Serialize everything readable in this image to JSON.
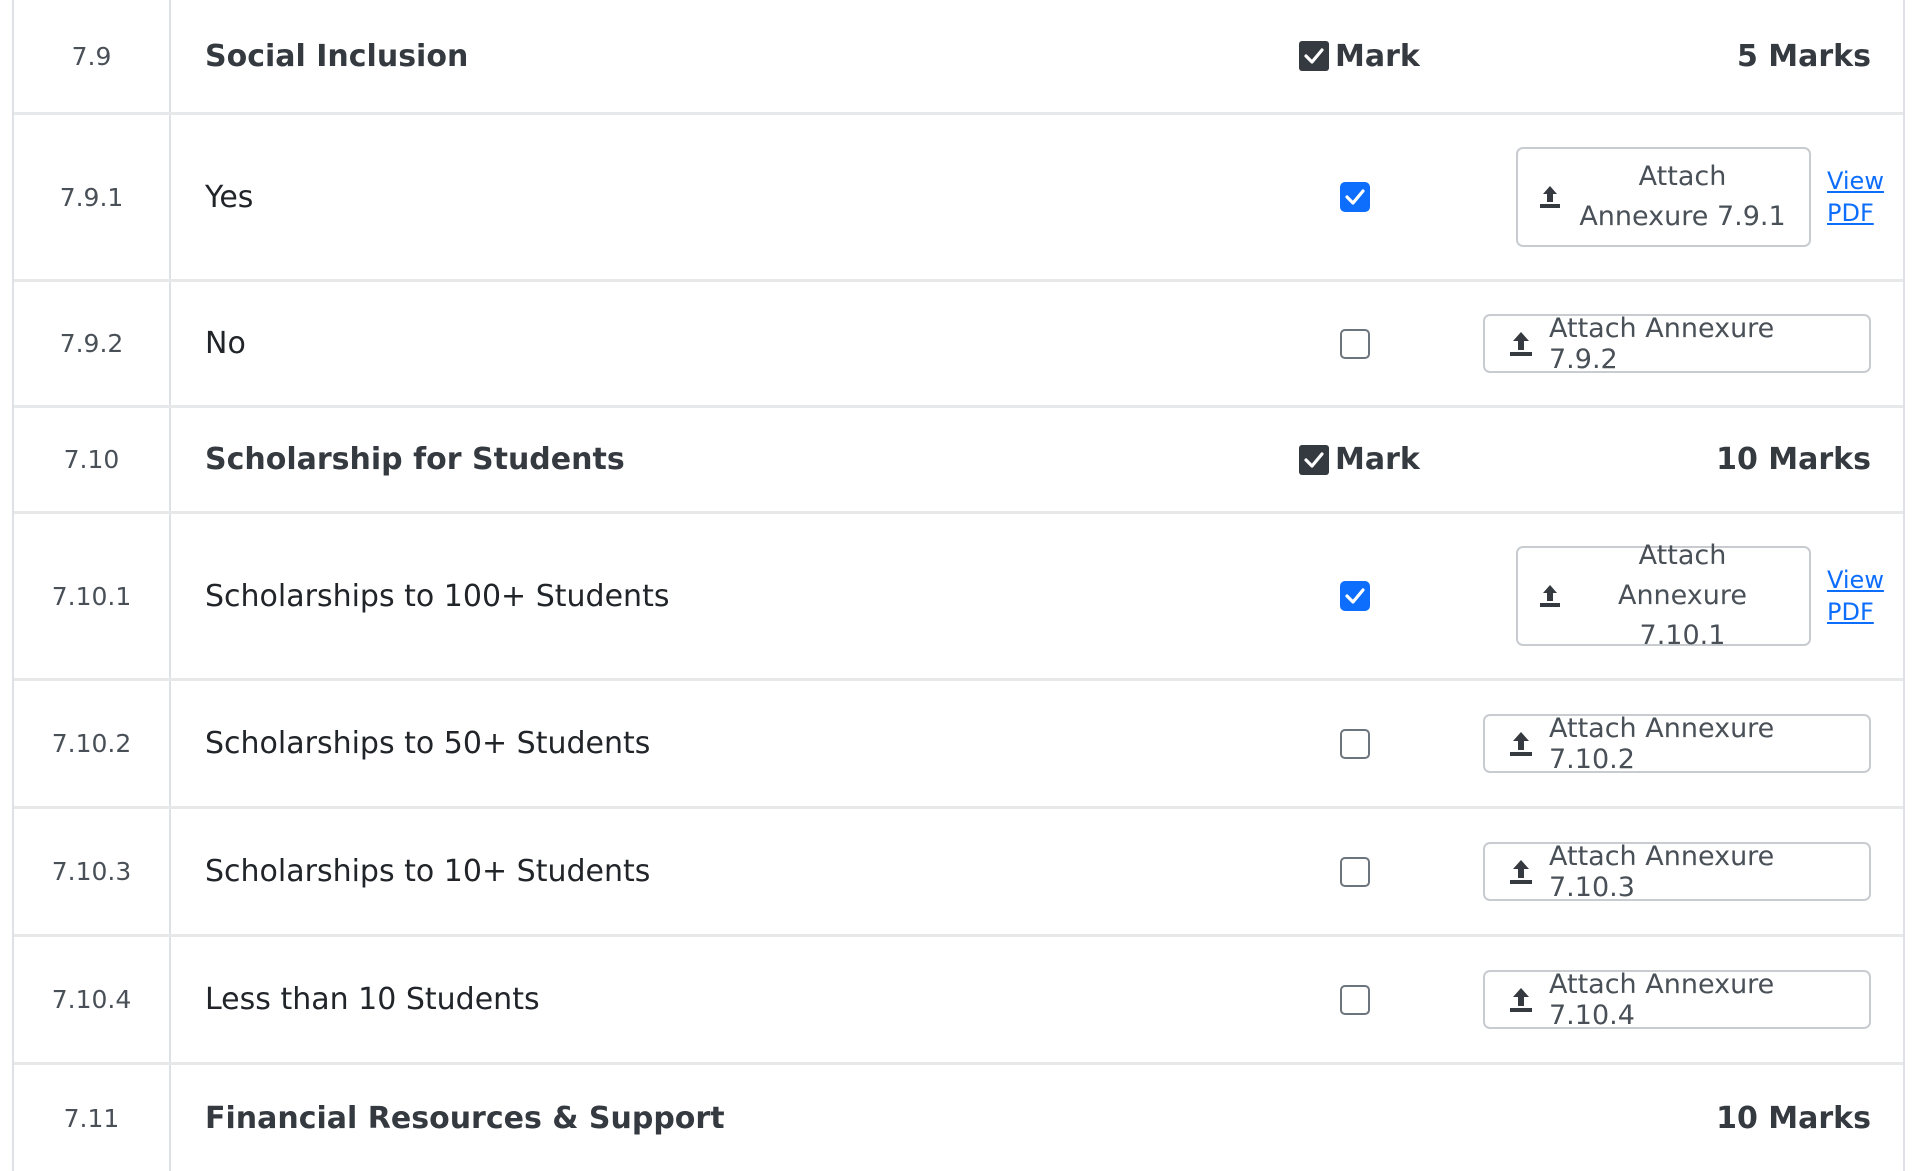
{
  "rows": [
    {
      "num": "7.9",
      "label": "Social Inclusion",
      "type": "section",
      "mark_label": "Mark",
      "marks": "5 Marks"
    },
    {
      "num": "7.9.1",
      "label": "Yes",
      "type": "option",
      "checked": true,
      "attach_line1": "Attach",
      "attach_line2": "Annexure 7.9.1",
      "view_line1": "View",
      "view_line2": "PDF"
    },
    {
      "num": "7.9.2",
      "label": "No",
      "type": "option",
      "checked": false,
      "attach": "Attach Annexure 7.9.2"
    },
    {
      "num": "7.10",
      "label": "Scholarship for Students",
      "type": "section",
      "mark_label": "Mark",
      "marks": "10 Marks"
    },
    {
      "num": "7.10.1",
      "label": "Scholarships to 100+ Students",
      "type": "option",
      "checked": true,
      "attach_line1": "Attach Annexure",
      "attach_line2": "7.10.1",
      "view_line1": "View",
      "view_line2": "PDF"
    },
    {
      "num": "7.10.2",
      "label": "Scholarships to 50+ Students",
      "type": "option",
      "checked": false,
      "attach": "Attach Annexure 7.10.2"
    },
    {
      "num": "7.10.3",
      "label": "Scholarships to 10+ Students",
      "type": "option",
      "checked": false,
      "attach": "Attach Annexure 7.10.3"
    },
    {
      "num": "7.10.4",
      "label": "Less than 10 Students",
      "type": "option",
      "checked": false,
      "attach": "Attach Annexure 7.10.4"
    },
    {
      "num": "7.11",
      "label": "Financial Resources & Support",
      "type": "section",
      "marks": "10 Marks"
    }
  ],
  "colors": {
    "checkbox_checked": "#0d6efd",
    "mark_box": "#343a40",
    "link": "#0d6efd",
    "border": "#dee2e6"
  },
  "icons": {
    "upload": "upload-icon",
    "check": "check-icon"
  }
}
